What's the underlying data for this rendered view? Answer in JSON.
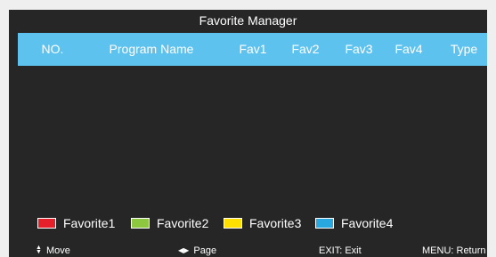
{
  "dialog": {
    "title": "Favorite Manager"
  },
  "table": {
    "columns": [
      "NO.",
      "Program Name",
      "Fav1",
      "Fav2",
      "Fav3",
      "Fav4",
      "Type"
    ],
    "rows": []
  },
  "legend": [
    {
      "label": "Favorite1",
      "color": "#e6202a"
    },
    {
      "label": "Favorite2",
      "color": "#8dc63f"
    },
    {
      "label": "Favorite3",
      "color": "#ffe000"
    },
    {
      "label": "Favorite4",
      "color": "#29a8e0"
    }
  ],
  "footer": {
    "move_label": "Move",
    "move_icon": "up-down-arrows-icon",
    "page_label": "Page",
    "page_icon": "left-right-arrows-icon",
    "exit_label": "EXIT: Exit",
    "return_label": "MENU: Return"
  },
  "colors": {
    "background": "#262626",
    "header_bar": "#5ec2ee",
    "page_background": "#efefef"
  }
}
